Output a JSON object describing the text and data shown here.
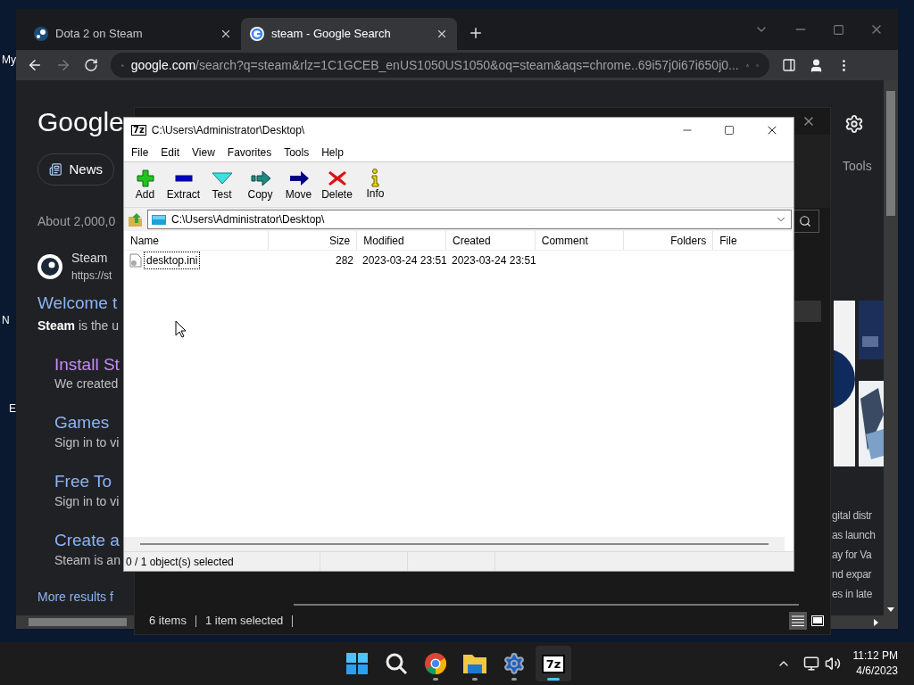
{
  "desktop": {
    "icon_labels": [
      "My",
      "N",
      "E"
    ]
  },
  "browser": {
    "tabs": [
      {
        "title": "Dota 2 on Steam",
        "kind": "steam",
        "selected": false
      },
      {
        "title": "steam - Google Search",
        "kind": "google",
        "selected": true
      }
    ],
    "address": {
      "domain": "google.com",
      "path": "/search?q=steam&rlz=1C1GCEB_enUS1050US1050&oq=steam&aqs=chrome..69i57j0i67i650j0..."
    },
    "page": {
      "logo": "Google",
      "chips": [
        "News"
      ],
      "tools": "Tools",
      "result_count": "About 2,000,0",
      "result": {
        "site": "Steam",
        "url": "https://st",
        "title": "Welcome t",
        "snippet": "**Steam** is the u"
      },
      "sitelinks": [
        {
          "title": "Install St",
          "desc": "We created",
          "visited": true
        },
        {
          "title": "Games",
          "desc": "Sign in to vi",
          "visited": false
        },
        {
          "title": "Free To",
          "desc": "Sign in to vi",
          "visited": false
        },
        {
          "title": "Create a",
          "desc": "Steam is an",
          "visited": false
        }
      ],
      "more": "More results f",
      "panel_lines": [
        "gital distr",
        "as launch",
        "ay for Va",
        "nd expar",
        "es in late"
      ]
    }
  },
  "explorer": {
    "status": [
      "6 items",
      "1 item selected"
    ],
    "views": [
      {
        "kind": "details",
        "selected": true
      },
      {
        "kind": "preview",
        "selected": false
      }
    ]
  },
  "archiver": {
    "icon_text": "7z",
    "title": "C:\\Users\\Administrator\\Desktop\\",
    "menu": [
      "File",
      "Edit",
      "View",
      "Favorites",
      "Tools",
      "Help"
    ],
    "toolbar": [
      {
        "label": "Add",
        "kind": "add"
      },
      {
        "label": "Extract",
        "kind": "extract"
      },
      {
        "label": "Test",
        "kind": "test"
      },
      {
        "label": "Copy",
        "kind": "copy"
      },
      {
        "label": "Move",
        "kind": "move"
      },
      {
        "label": "Delete",
        "kind": "delete"
      },
      {
        "label": "Info",
        "kind": "info"
      }
    ],
    "path": "C:\\Users\\Administrator\\Desktop\\",
    "columns": [
      "Name",
      "Size",
      "Modified",
      "Created",
      "Comment",
      "Folders",
      "File"
    ],
    "rows": [
      {
        "cells": [
          "desktop.ini",
          "282",
          "2023-03-24 23:51",
          "2023-03-24 23:51"
        ],
        "focused": true
      }
    ],
    "status": "0 / 1 object(s) selected"
  },
  "taskbar": {
    "apps": [
      {
        "kind": "start",
        "running": false,
        "active": false
      },
      {
        "kind": "search",
        "running": false,
        "active": false
      },
      {
        "kind": "chrome",
        "running": true,
        "active": false
      },
      {
        "kind": "folder",
        "running": true,
        "active": false
      },
      {
        "kind": "settings",
        "running": true,
        "active": false
      },
      {
        "kind": "archiver",
        "label": "7z",
        "running": true,
        "active": true
      }
    ],
    "time": "11:12 PM",
    "date": "4/6/2023"
  }
}
